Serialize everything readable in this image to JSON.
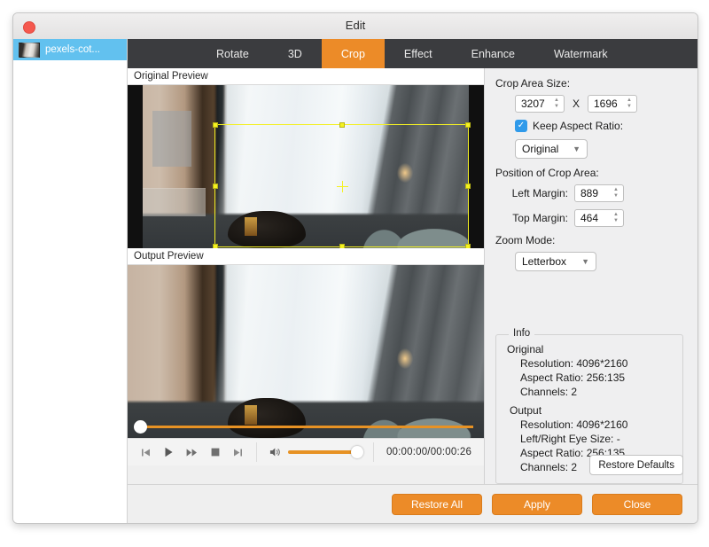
{
  "window": {
    "title": "Edit",
    "close_icon": "close-dot"
  },
  "sidebar": {
    "items": [
      {
        "label": "pexels-cot...",
        "thumb": "video-thumbnail"
      }
    ]
  },
  "tabs": [
    {
      "label": "Rotate",
      "active": false
    },
    {
      "label": "3D",
      "active": false
    },
    {
      "label": "Crop",
      "active": true
    },
    {
      "label": "Effect",
      "active": false
    },
    {
      "label": "Enhance",
      "active": false
    },
    {
      "label": "Watermark",
      "active": false
    }
  ],
  "previews": {
    "original_label": "Original Preview",
    "output_label": "Output Preview"
  },
  "transport": {
    "prev_icon": "skip-previous-icon",
    "play_icon": "play-icon",
    "forward_icon": "fast-forward-icon",
    "stop_icon": "stop-icon",
    "next_icon": "skip-next-icon",
    "volume_icon": "speaker-icon",
    "time": "00:00:00/00:00:26"
  },
  "settings": {
    "crop_area_size_label": "Crop Area Size:",
    "width_value": "3207",
    "separator": "X",
    "height_value": "1696",
    "keep_aspect_label": "Keep Aspect Ratio:",
    "keep_aspect_checked": true,
    "aspect_ratio_value": "Original",
    "position_label": "Position of Crop Area:",
    "left_margin_label": "Left Margin:",
    "left_margin_value": "889",
    "top_margin_label": "Top Margin:",
    "top_margin_value": "464",
    "zoom_mode_label": "Zoom Mode:",
    "zoom_mode_value": "Letterbox"
  },
  "info": {
    "legend": "Info",
    "original_head": "Original",
    "original_lines": [
      "Resolution: 4096*2160",
      "Aspect Ratio: 256:135",
      "Channels: 2"
    ],
    "output_head": "Output",
    "output_lines": [
      "Resolution: 4096*2160",
      "Left/Right Eye Size: -",
      "Aspect Ratio: 256:135",
      "Channels: 2"
    ],
    "restore_defaults_label": "Restore Defaults"
  },
  "footer": {
    "restore_all_label": "Restore All",
    "apply_label": "Apply",
    "close_label": "Close"
  },
  "colors": {
    "accent": "#ec8b28",
    "tabbar": "#3b3c3f",
    "selection": "#62c1ef",
    "crop_outline": "#f3f024",
    "checkbox": "#2f9aea"
  }
}
